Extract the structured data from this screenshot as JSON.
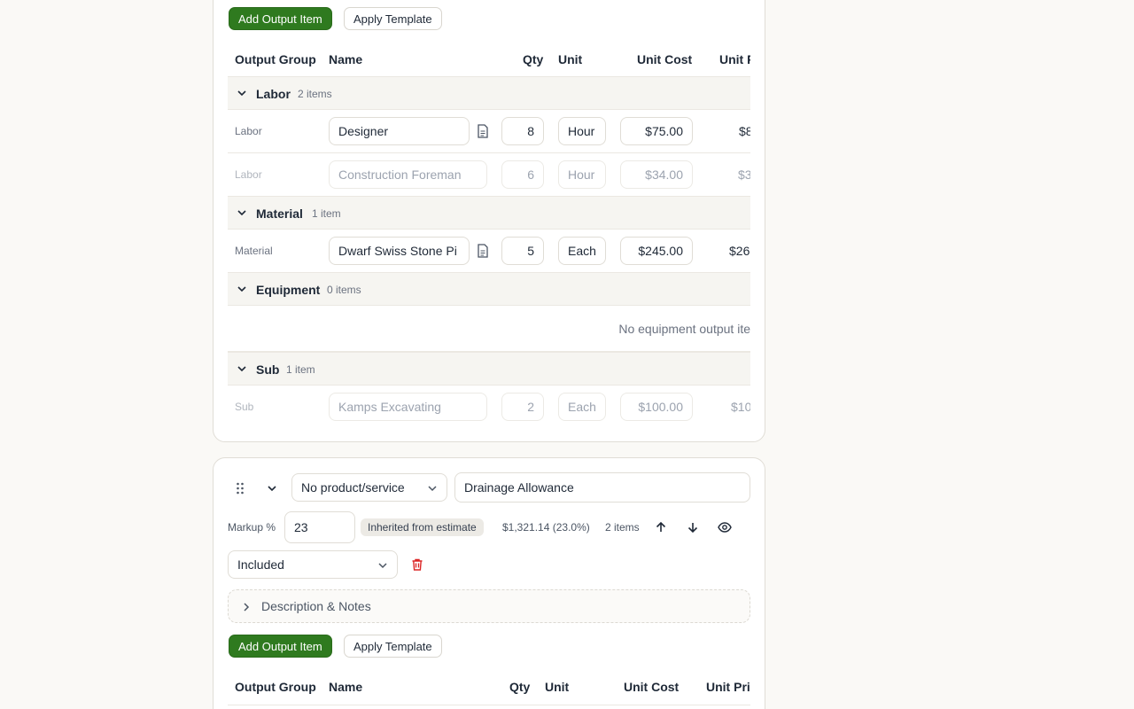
{
  "toolbar": {
    "add_output_item": "Add Output Item",
    "apply_template": "Apply Template"
  },
  "table": {
    "columns": [
      "Output Group",
      "Name",
      "Qty",
      "Unit",
      "Unit Cost",
      "Unit P"
    ],
    "columns_second": [
      "Output Group",
      "Name",
      "Qty",
      "Unit",
      "Unit Cost",
      "Unit Pri"
    ]
  },
  "groups": {
    "labor": {
      "name": "Labor",
      "count": "2 items"
    },
    "material": {
      "name": "Material",
      "count": "1 item"
    },
    "equipment": {
      "name": "Equipment",
      "count": "0 items",
      "empty": "No equipment output ite"
    },
    "sub": {
      "name": "Sub",
      "count": "1 item"
    }
  },
  "rows": [
    {
      "group": "Labor",
      "name": "Designer",
      "qty": "8",
      "unit": "Hour",
      "unit_cost": "$75.00",
      "unit_price": "$8"
    },
    {
      "group": "Labor",
      "name": "Construction Foreman",
      "qty": "6",
      "unit": "Hour",
      "unit_cost": "$34.00",
      "unit_price": "$3"
    },
    {
      "group": "Material",
      "name": "Dwarf Swiss Stone Pi",
      "qty": "5",
      "unit": "Each",
      "unit_cost": "$245.00",
      "unit_price": "$26"
    },
    {
      "group": "Sub",
      "name": "Kamps Excavating",
      "qty": "2",
      "unit": "Each",
      "unit_cost": "$100.00",
      "unit_price": "$10"
    }
  ],
  "section2": {
    "product_select": "No product/service",
    "title_value": "Drainage Allowance",
    "markup_label": "Markup %",
    "markup_value": "23",
    "inherited_badge": "Inherited from estimate",
    "markup_amount": "$1,321.14 (23.0%)",
    "item_count": "2 items",
    "inclusion_select": "Included",
    "description_toggle": "Description & Notes"
  },
  "colors": {
    "primary": "#2f7a1f",
    "danger": "#dc2626",
    "background": "#faf9f6"
  }
}
